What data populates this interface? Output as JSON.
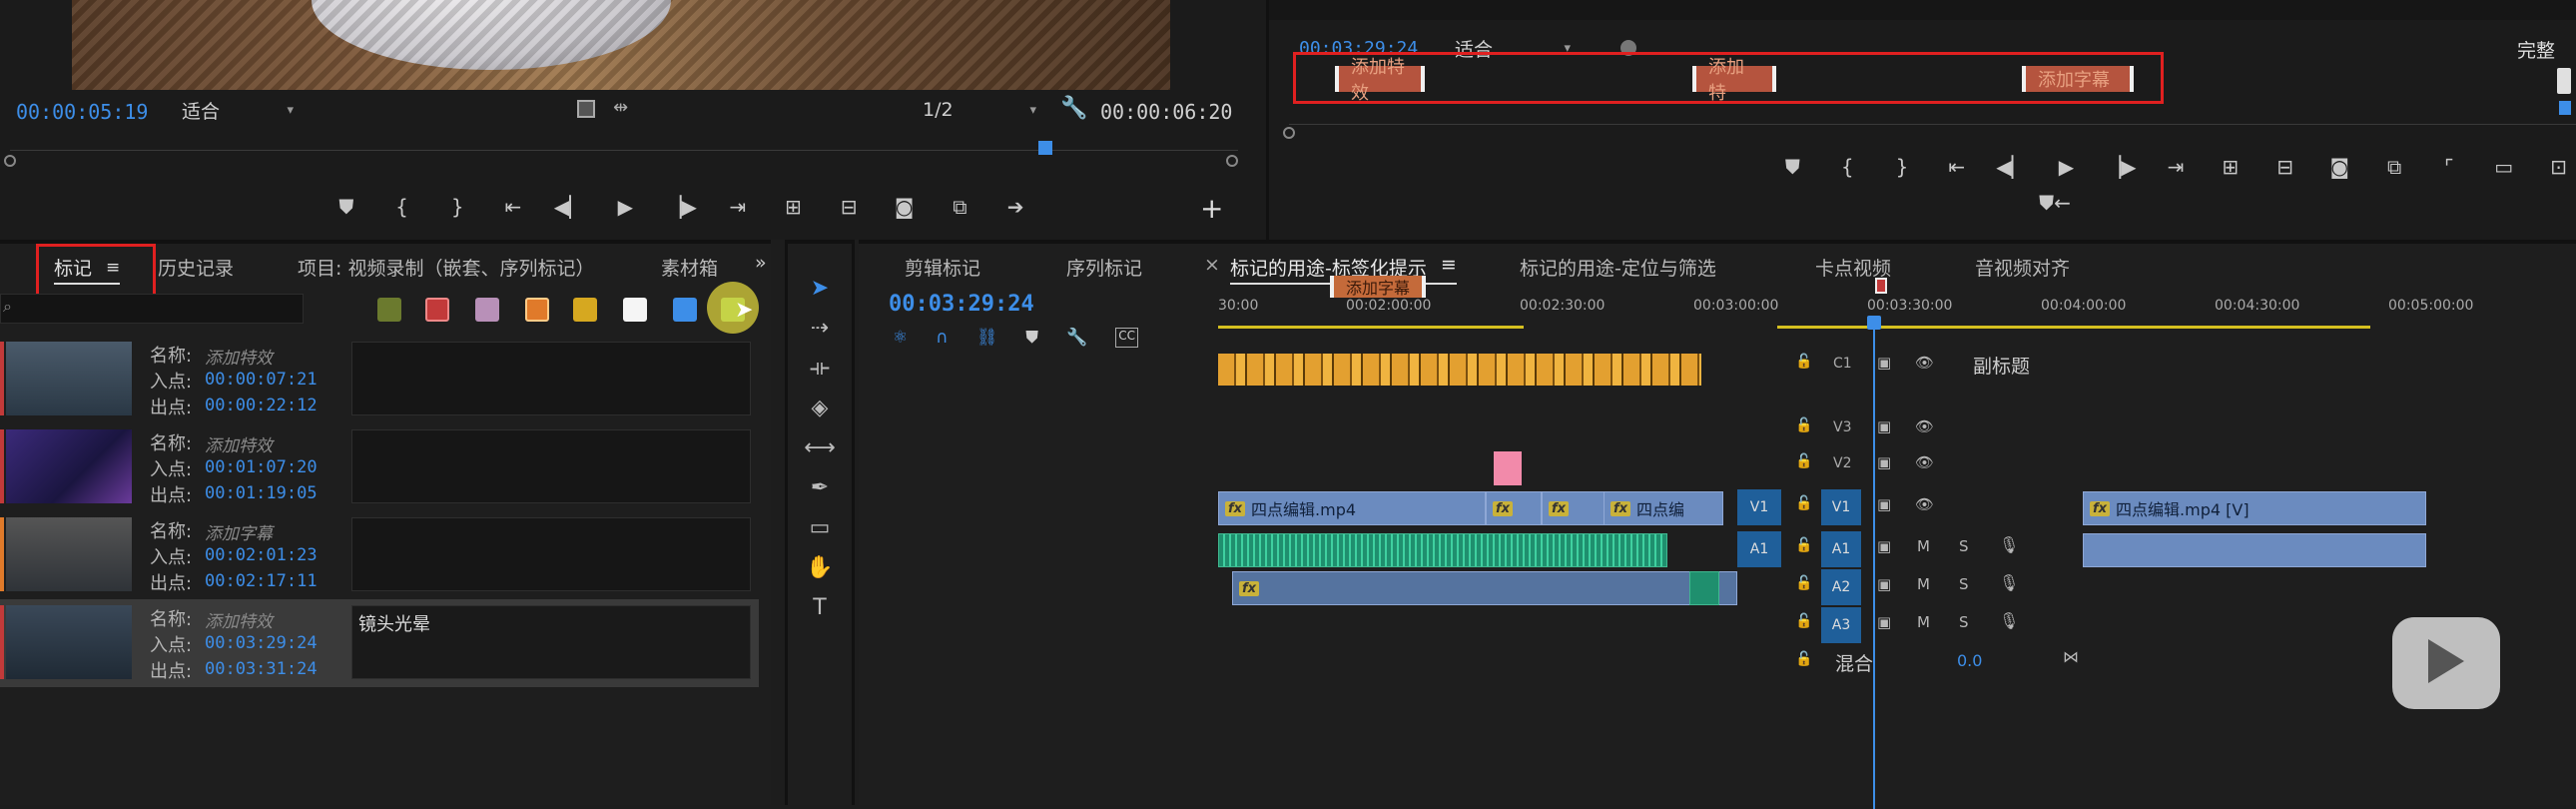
{
  "source_monitor": {
    "timecode_in": "00:00:05:19",
    "zoom": "适合",
    "resolution": "1/2",
    "timecode_duration": "00:00:06:20"
  },
  "program_monitor": {
    "timecode": "00:03:29:24",
    "zoom": "适合",
    "quality": "完整",
    "markers": [
      "添加特效",
      "添加特",
      "添加字幕"
    ]
  },
  "left_panel": {
    "tabs": [
      "标记",
      "历史记录",
      "项目: 视频录制（嵌套、序列标记）",
      "素材箱"
    ],
    "labels": {
      "name": "名称:",
      "in": "入点:",
      "out": "出点:"
    },
    "markers": [
      {
        "name": "添加特效",
        "in": "00:00:07:21",
        "out": "00:00:22:12",
        "comment": ""
      },
      {
        "name": "添加特效",
        "in": "00:01:07:20",
        "out": "00:01:19:05",
        "comment": ""
      },
      {
        "name": "添加字幕",
        "in": "00:02:01:23",
        "out": "00:02:17:11",
        "comment": ""
      },
      {
        "name": "添加特效",
        "in": "00:03:29:24",
        "out": "00:03:31:24",
        "comment": "镜头光晕"
      }
    ],
    "swatch_colors": [
      "#6b7a2e",
      "#c23a3a",
      "#b890b8",
      "#e07a2a",
      "#d6a820",
      "#f5f5f5",
      "#3d8ee8",
      "#7fd66a"
    ]
  },
  "timeline": {
    "tabs": [
      "剪辑标记",
      "序列标记",
      "标记的用途-标签化提示",
      "标记的用途-定位与筛选",
      "卡点视频",
      "音视频对齐"
    ],
    "timecode": "00:03:29:24",
    "ruler": [
      "30:00",
      "00:02:00:00",
      "00:02:30:00",
      "00:03:00:00",
      "00:03:30:00",
      "00:04:00:00",
      "00:04:30:00",
      "00:05:00:00"
    ],
    "ruler_marker": "添加字幕",
    "tracks": {
      "caption": {
        "id": "C1",
        "label": "副标题"
      },
      "video": [
        "V3",
        "V2",
        "V1"
      ],
      "audio": [
        "A1",
        "A2",
        "A3"
      ],
      "source_v": "V1",
      "source_a": "A1",
      "mix_label": "混合",
      "mix_value": "0.0",
      "m_label": "M",
      "s_label": "S"
    },
    "clips": {
      "v1_a": "四点编辑.mp4",
      "v1_b": "四点编",
      "v1_c": "四点编辑.mp4 [V]",
      "fx": "fx"
    }
  },
  "tools": [
    "selection",
    "track-select",
    "ripple-edit",
    "razor",
    "slip",
    "pen",
    "rectangle",
    "hand",
    "type"
  ]
}
